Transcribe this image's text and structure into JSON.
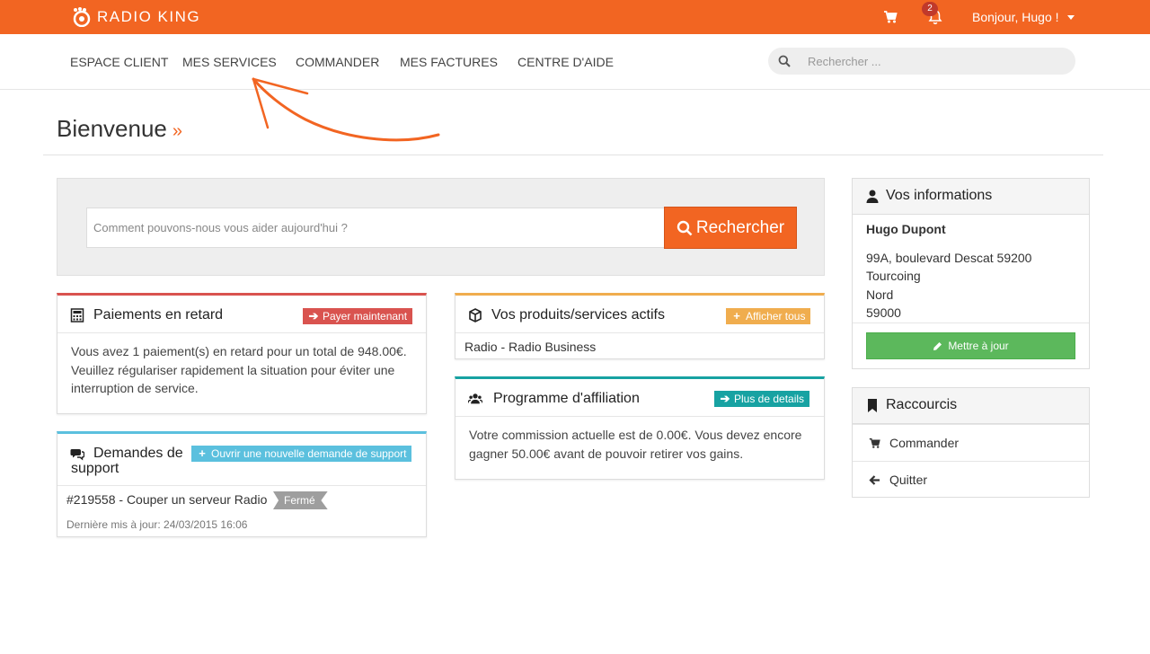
{
  "brand": {
    "name": "RADIO KING",
    "accent": "#f26522"
  },
  "topbar": {
    "notifications_count": "2",
    "greeting": "Bonjour, Hugo !"
  },
  "nav": {
    "items": [
      {
        "label": "ESPACE CLIENT"
      },
      {
        "label": "MES SERVICES"
      },
      {
        "label": "COMMANDER"
      },
      {
        "label": "MES FACTURES"
      },
      {
        "label": "CENTRE D'AIDE"
      }
    ],
    "search_placeholder": "Rechercher ..."
  },
  "page": {
    "title": "Bienvenue",
    "title_chevron": "»"
  },
  "hero": {
    "placeholder": "Comment pouvons-nous vous aider aujourd'hui ?",
    "button_label": "Rechercher"
  },
  "panels": {
    "payments": {
      "title": "Paiements en retard",
      "action_label": "Payer maintenant",
      "color": "#d9534f",
      "body": "Vous avez 1 paiement(s) en retard pour un total de 948.00€. Veuillez régulariser rapidement la situation pour éviter une interruption de service."
    },
    "tickets": {
      "title_line1": "Demandes de",
      "title_line2": "support",
      "action_label": "Ouvrir une nouvelle demande de support",
      "color": "#5bc0de",
      "items": [
        {
          "title": "#219558 - Couper un serveur Radio",
          "status": "Fermé",
          "updated": "Dernière mis à jour: 24/03/2015 16:06"
        }
      ]
    },
    "products": {
      "title": "Vos produits/services actifs",
      "action_label": "Afficher tous",
      "color": "#f0ad4e",
      "items": [
        {
          "label": "Radio - Radio Business"
        }
      ]
    },
    "affiliation": {
      "title": "Programme d'affiliation",
      "action_label": "Plus de details",
      "color": "#17a2a2",
      "body": "Votre commission actuelle est de 0.00€. Vous devez encore gagner 50.00€ avant de pouvoir retirer vos gains."
    }
  },
  "sidebar": {
    "info": {
      "title": "Vos informations",
      "name": "Hugo Dupont",
      "address_lines": [
        "99A, boulevard Descat 59200",
        "Tourcoing",
        "Nord",
        "59000"
      ],
      "update_label": "Mettre à jour"
    },
    "shortcuts": {
      "title": "Raccourcis",
      "items": [
        {
          "label": "Commander",
          "icon": "cart-icon"
        },
        {
          "label": "Quitter",
          "icon": "arrow-left-icon"
        }
      ]
    }
  }
}
